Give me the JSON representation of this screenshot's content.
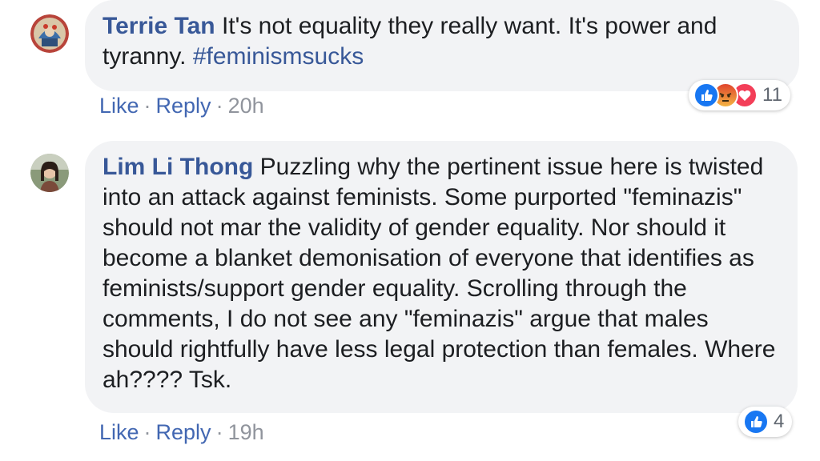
{
  "comments": [
    {
      "author": "Terrie Tan",
      "text": "It's not equality they really want. It's power and tyranny. ",
      "hashtag": "#feminismsucks",
      "actions": {
        "like": "Like",
        "reply": "Reply",
        "separator": "·",
        "time": "20h"
      },
      "reactions": {
        "count": "11",
        "icons": [
          "like-icon",
          "angry-icon",
          "love-icon"
        ]
      }
    },
    {
      "author": "Lim Li Thong",
      "text": "Puzzling why the pertinent issue here is twisted into an attack against feminists. Some purported \"feminazis\" should not mar the validity of gender equality. Nor should it become a blanket demonisation of everyone that identifies as feminists/support gender equality. Scrolling through the comments, I do not see any \"feminazis\" argue that males should rightfully have less legal protection than females. Where ah???? Tsk.",
      "actions": {
        "like": "Like",
        "reply": "Reply",
        "separator": "·",
        "time": "19h"
      },
      "reactions": {
        "count": "4",
        "icons": [
          "like-icon"
        ]
      }
    }
  ],
  "colors": {
    "author": "#385898",
    "link": "#4267b2",
    "bubble": "#f2f3f5",
    "muted": "#90949c",
    "like_blue": "#1877f2",
    "love_red": "#f33e58",
    "angry_orange": "#e9710f"
  }
}
